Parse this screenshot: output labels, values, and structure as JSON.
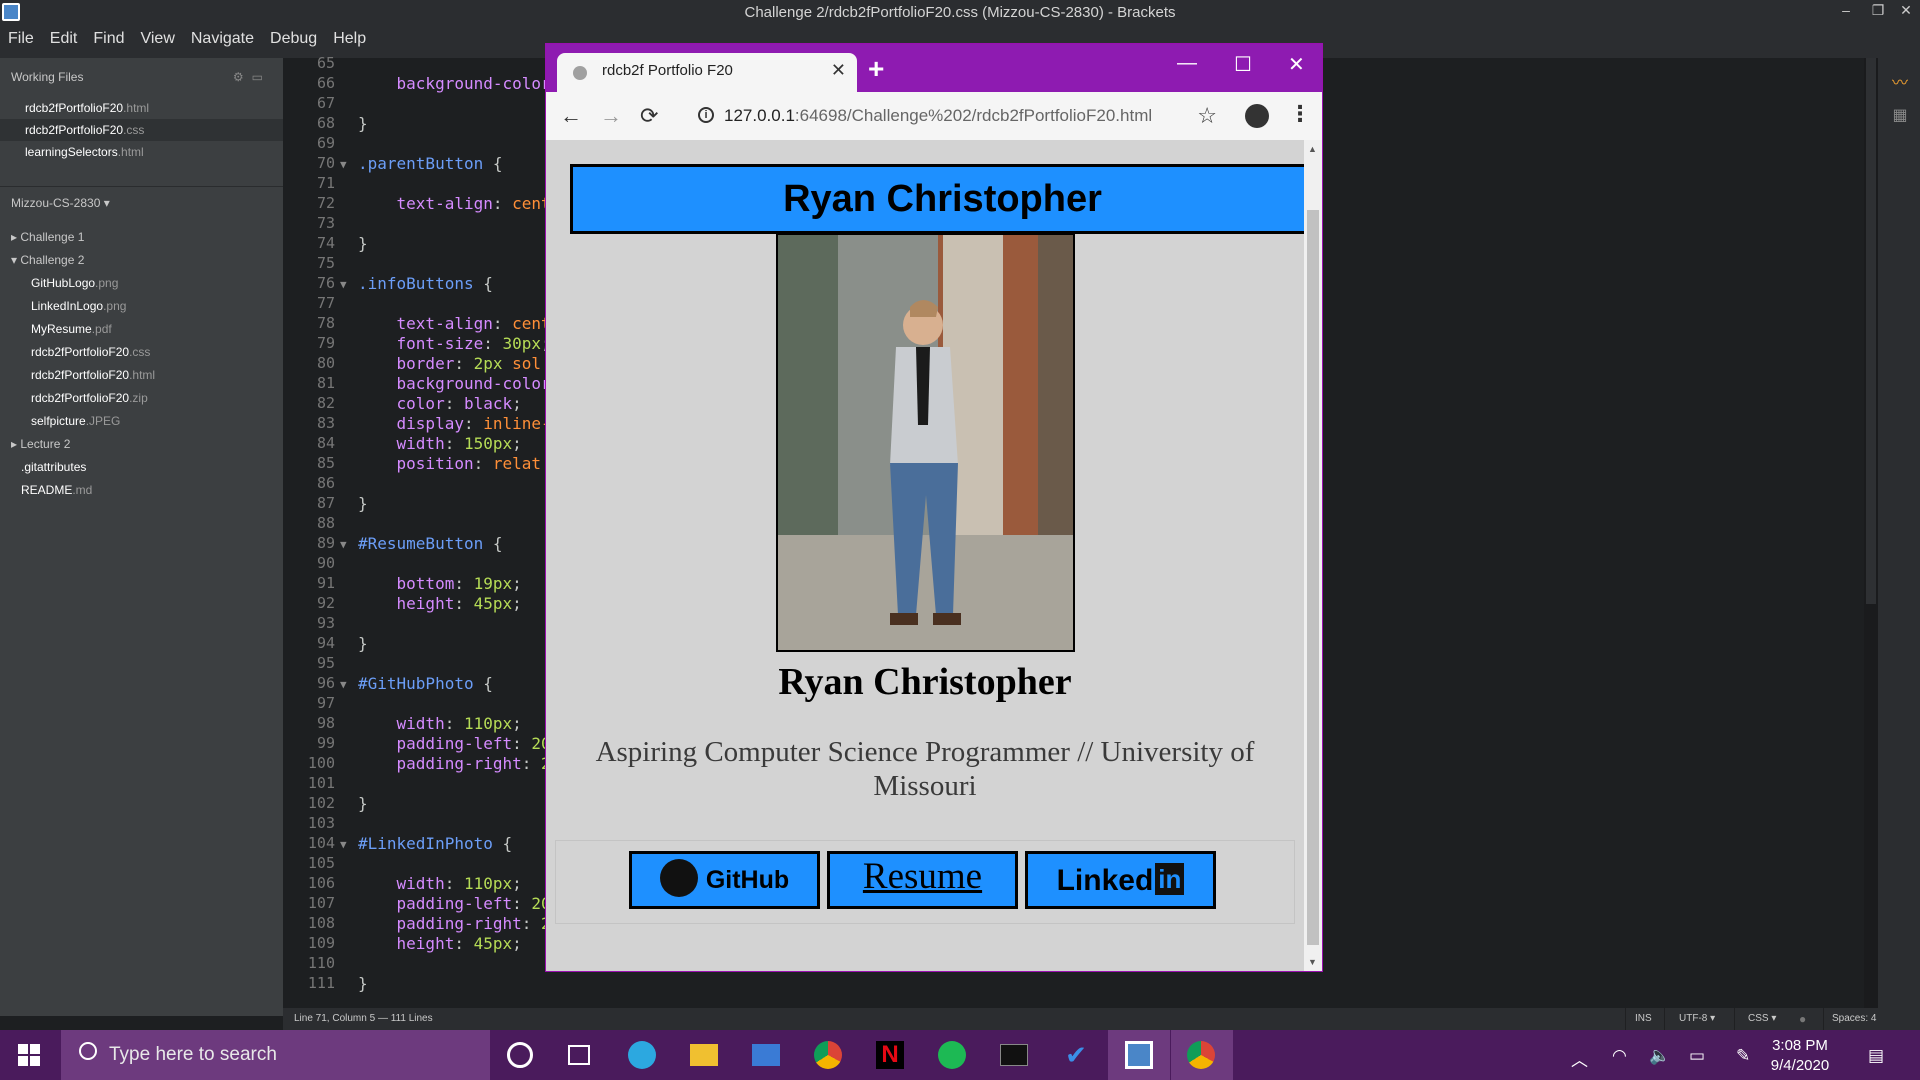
{
  "window": {
    "title": "Challenge 2/rdcb2fPortfolioF20.css (Mizzou-CS-2830) - Brackets",
    "controls": {
      "minimize": "–",
      "restore": "❐",
      "close": "✕"
    }
  },
  "menu": [
    "File",
    "Edit",
    "Find",
    "View",
    "Navigate",
    "Debug",
    "Help"
  ],
  "sidebar": {
    "working_files_title": "Working Files",
    "working_files": [
      {
        "name": "rdcb2fPortfolioF20",
        "ext": ".html"
      },
      {
        "name": "rdcb2fPortfolioF20",
        "ext": ".css"
      },
      {
        "name": "learningSelectors",
        "ext": ".html"
      }
    ],
    "project_title": "Mizzou-CS-2830 ▾",
    "tree": [
      {
        "label": "▸ Challenge 1",
        "type": "folder"
      },
      {
        "label": "▾ Challenge 2",
        "type": "folder"
      },
      {
        "name": "GitHubLogo",
        "ext": ".png"
      },
      {
        "name": "LinkedInLogo",
        "ext": ".png"
      },
      {
        "name": "MyResume",
        "ext": ".pdf"
      },
      {
        "name": "rdcb2fPortfolioF20",
        "ext": ".css"
      },
      {
        "name": "rdcb2fPortfolioF20",
        "ext": ".html"
      },
      {
        "name": "rdcb2fPortfolioF20",
        "ext": ".zip"
      },
      {
        "name": "selfpicture",
        "ext": ".JPEG"
      },
      {
        "label": "▸ Lecture 2",
        "type": "folder"
      },
      {
        "name": ".gitattributes",
        "ext": ""
      },
      {
        "name": "README",
        "ext": ".md"
      }
    ]
  },
  "editor": {
    "lines": [
      {
        "n": "65",
        "parts": []
      },
      {
        "n": "66",
        "parts": [
          [
            "prop",
            "    background-color"
          ]
        ]
      },
      {
        "n": "67",
        "parts": []
      },
      {
        "n": "68",
        "parts": [
          [
            "plain",
            "}"
          ]
        ]
      },
      {
        "n": "69",
        "parts": []
      },
      {
        "n": "70",
        "fold": true,
        "parts": [
          [
            "sel",
            ".parentButton"
          ],
          [
            "plain",
            " {"
          ]
        ]
      },
      {
        "n": "71",
        "parts": []
      },
      {
        "n": "72",
        "parts": [
          [
            "prop",
            "    text-align"
          ],
          [
            "plain",
            ": "
          ],
          [
            "val",
            "cent"
          ]
        ]
      },
      {
        "n": "73",
        "parts": []
      },
      {
        "n": "74",
        "parts": [
          [
            "plain",
            "}"
          ]
        ]
      },
      {
        "n": "75",
        "parts": []
      },
      {
        "n": "76",
        "fold": true,
        "parts": [
          [
            "sel",
            ".infoButtons"
          ],
          [
            "plain",
            " {"
          ]
        ]
      },
      {
        "n": "77",
        "parts": []
      },
      {
        "n": "78",
        "parts": [
          [
            "prop",
            "    text-align"
          ],
          [
            "plain",
            ": "
          ],
          [
            "val",
            "cent"
          ]
        ]
      },
      {
        "n": "79",
        "parts": [
          [
            "prop",
            "    font-size"
          ],
          [
            "plain",
            ": "
          ],
          [
            "num",
            "30px"
          ],
          [
            "plain",
            ";"
          ]
        ]
      },
      {
        "n": "80",
        "parts": [
          [
            "prop",
            "    border"
          ],
          [
            "plain",
            ": "
          ],
          [
            "num",
            "2px"
          ],
          [
            "val",
            " sol"
          ]
        ]
      },
      {
        "n": "81",
        "parts": [
          [
            "prop",
            "    background-color"
          ]
        ]
      },
      {
        "n": "82",
        "parts": [
          [
            "prop",
            "    color"
          ],
          [
            "plain",
            ": "
          ],
          [
            "kw",
            "black"
          ],
          [
            "plain",
            ";"
          ]
        ]
      },
      {
        "n": "83",
        "parts": [
          [
            "prop",
            "    display"
          ],
          [
            "plain",
            ": "
          ],
          [
            "val",
            "inline-"
          ]
        ]
      },
      {
        "n": "84",
        "parts": [
          [
            "prop",
            "    width"
          ],
          [
            "plain",
            ": "
          ],
          [
            "num",
            "150px"
          ],
          [
            "plain",
            ";"
          ]
        ]
      },
      {
        "n": "85",
        "parts": [
          [
            "prop",
            "    position"
          ],
          [
            "plain",
            ": "
          ],
          [
            "val",
            "relat"
          ]
        ]
      },
      {
        "n": "86",
        "parts": []
      },
      {
        "n": "87",
        "parts": [
          [
            "plain",
            "}"
          ]
        ]
      },
      {
        "n": "88",
        "parts": []
      },
      {
        "n": "89",
        "fold": true,
        "parts": [
          [
            "sel",
            "#ResumeButton"
          ],
          [
            "plain",
            " {"
          ]
        ]
      },
      {
        "n": "90",
        "parts": []
      },
      {
        "n": "91",
        "parts": [
          [
            "prop",
            "    bottom"
          ],
          [
            "plain",
            ": "
          ],
          [
            "num",
            "19px"
          ],
          [
            "plain",
            ";"
          ]
        ]
      },
      {
        "n": "92",
        "parts": [
          [
            "prop",
            "    height"
          ],
          [
            "plain",
            ": "
          ],
          [
            "num",
            "45px"
          ],
          [
            "plain",
            ";"
          ]
        ]
      },
      {
        "n": "93",
        "parts": []
      },
      {
        "n": "94",
        "parts": [
          [
            "plain",
            "}"
          ]
        ]
      },
      {
        "n": "95",
        "parts": []
      },
      {
        "n": "96",
        "fold": true,
        "parts": [
          [
            "sel",
            "#GitHubPhoto"
          ],
          [
            "plain",
            " {"
          ]
        ]
      },
      {
        "n": "97",
        "parts": []
      },
      {
        "n": "98",
        "parts": [
          [
            "prop",
            "    width"
          ],
          [
            "plain",
            ": "
          ],
          [
            "num",
            "110px"
          ],
          [
            "plain",
            ";"
          ]
        ]
      },
      {
        "n": "99",
        "parts": [
          [
            "prop",
            "    padding-left"
          ],
          [
            "plain",
            ": "
          ],
          [
            "num",
            "20"
          ]
        ]
      },
      {
        "n": "100",
        "parts": [
          [
            "prop",
            "    padding-right"
          ],
          [
            "plain",
            ": "
          ],
          [
            "num",
            "2"
          ]
        ]
      },
      {
        "n": "101",
        "parts": []
      },
      {
        "n": "102",
        "parts": [
          [
            "plain",
            "}"
          ]
        ]
      },
      {
        "n": "103",
        "parts": []
      },
      {
        "n": "104",
        "fold": true,
        "parts": [
          [
            "sel",
            "#LinkedInPhoto"
          ],
          [
            "plain",
            " {"
          ]
        ]
      },
      {
        "n": "105",
        "parts": []
      },
      {
        "n": "106",
        "parts": [
          [
            "prop",
            "    width"
          ],
          [
            "plain",
            ": "
          ],
          [
            "num",
            "110px"
          ],
          [
            "plain",
            ";"
          ]
        ]
      },
      {
        "n": "107",
        "parts": [
          [
            "prop",
            "    padding-left"
          ],
          [
            "plain",
            ": "
          ],
          [
            "num",
            "20"
          ]
        ]
      },
      {
        "n": "108",
        "parts": [
          [
            "prop",
            "    padding-right"
          ],
          [
            "plain",
            ": "
          ],
          [
            "num",
            "2"
          ]
        ]
      },
      {
        "n": "109",
        "parts": [
          [
            "prop",
            "    height"
          ],
          [
            "plain",
            ": "
          ],
          [
            "num",
            "45px"
          ],
          [
            "plain",
            ";"
          ]
        ]
      },
      {
        "n": "110",
        "parts": []
      },
      {
        "n": "111",
        "parts": [
          [
            "plain",
            "}"
          ]
        ]
      }
    ]
  },
  "statusbar": {
    "position": "Line 71, Column 5 — 111 Lines",
    "mode": "INS",
    "encoding": "UTF-8 ▾",
    "language": "CSS ▾",
    "spaces": "Spaces: 4"
  },
  "browser": {
    "tab_title": "rdcb2f Portfolio F20",
    "tab_close": "✕",
    "new_tab": "+",
    "controls": {
      "minimize": "—",
      "maximize": "☐",
      "close": "✕"
    },
    "nav": {
      "back": "←",
      "forward": "→",
      "reload": "⟳",
      "menu": "⋮",
      "star": "☆"
    },
    "url_host": "127.0.0.1",
    "url_rest": ":64698/Challenge%202/rdcb2fPortfolioF20.html",
    "page": {
      "banner": "Ryan Christopher",
      "name": "Ryan Christopher",
      "tagline": "Aspiring Computer Science Programmer // University of Missouri",
      "buttons": {
        "github": "GitHub",
        "resume": "Resume",
        "linkedin_text": "Linked",
        "linkedin_box": "in"
      }
    }
  },
  "taskbar": {
    "search_placeholder": "Type here to search",
    "time": "3:08 PM",
    "date": "9/4/2020"
  },
  "colors": {
    "accent_purple": "#8e1bb1",
    "page_blue": "#1e90ff",
    "taskbar": "#4a1b5c"
  }
}
